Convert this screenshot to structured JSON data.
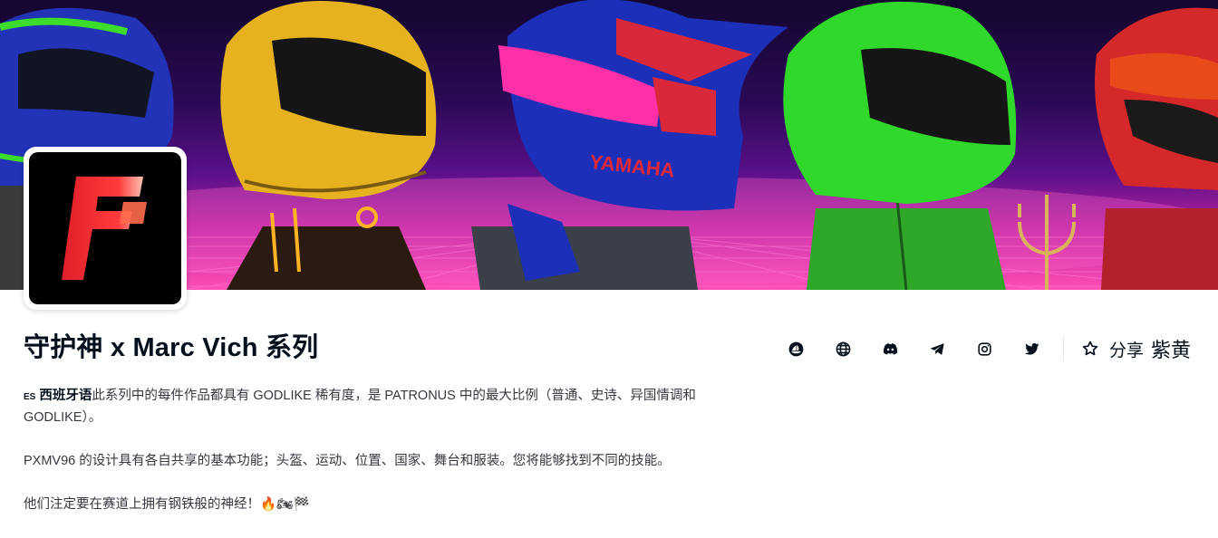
{
  "collection": {
    "title": "守护神 x Marc Vich 系列",
    "avatar_letter": "F"
  },
  "actions": {
    "icons": [
      "opensea-icon",
      "globe-icon",
      "discord-icon",
      "telegram-icon",
      "instagram-icon",
      "twitter-icon"
    ],
    "favorite_icon": "star-icon",
    "share_label": "分享",
    "extra_label": "紫黄"
  },
  "description": {
    "lang_code": "ES",
    "lang_name": "西班牙语",
    "paragraph1": "此系列中的每件作品都具有 GODLIKE 稀有度，是 PATRONUS 中的最大比例（普通、史诗、异国情调和 GODLIKE）。",
    "paragraph2": "PXMV96 的设计具有各自共享的基本功能；头盔、运动、位置、国家、舞台和服装。您将能够找到不同的技能。",
    "paragraph3": "他们注定要在赛道上拥有钢铁般的神经！🔥🏍🏁"
  },
  "banner": {
    "helmet_text": "YAMAHA",
    "colors": [
      "#1c2fb8",
      "#e6b21f",
      "#d8283a",
      "#2fd82a",
      "#d4282b"
    ]
  }
}
